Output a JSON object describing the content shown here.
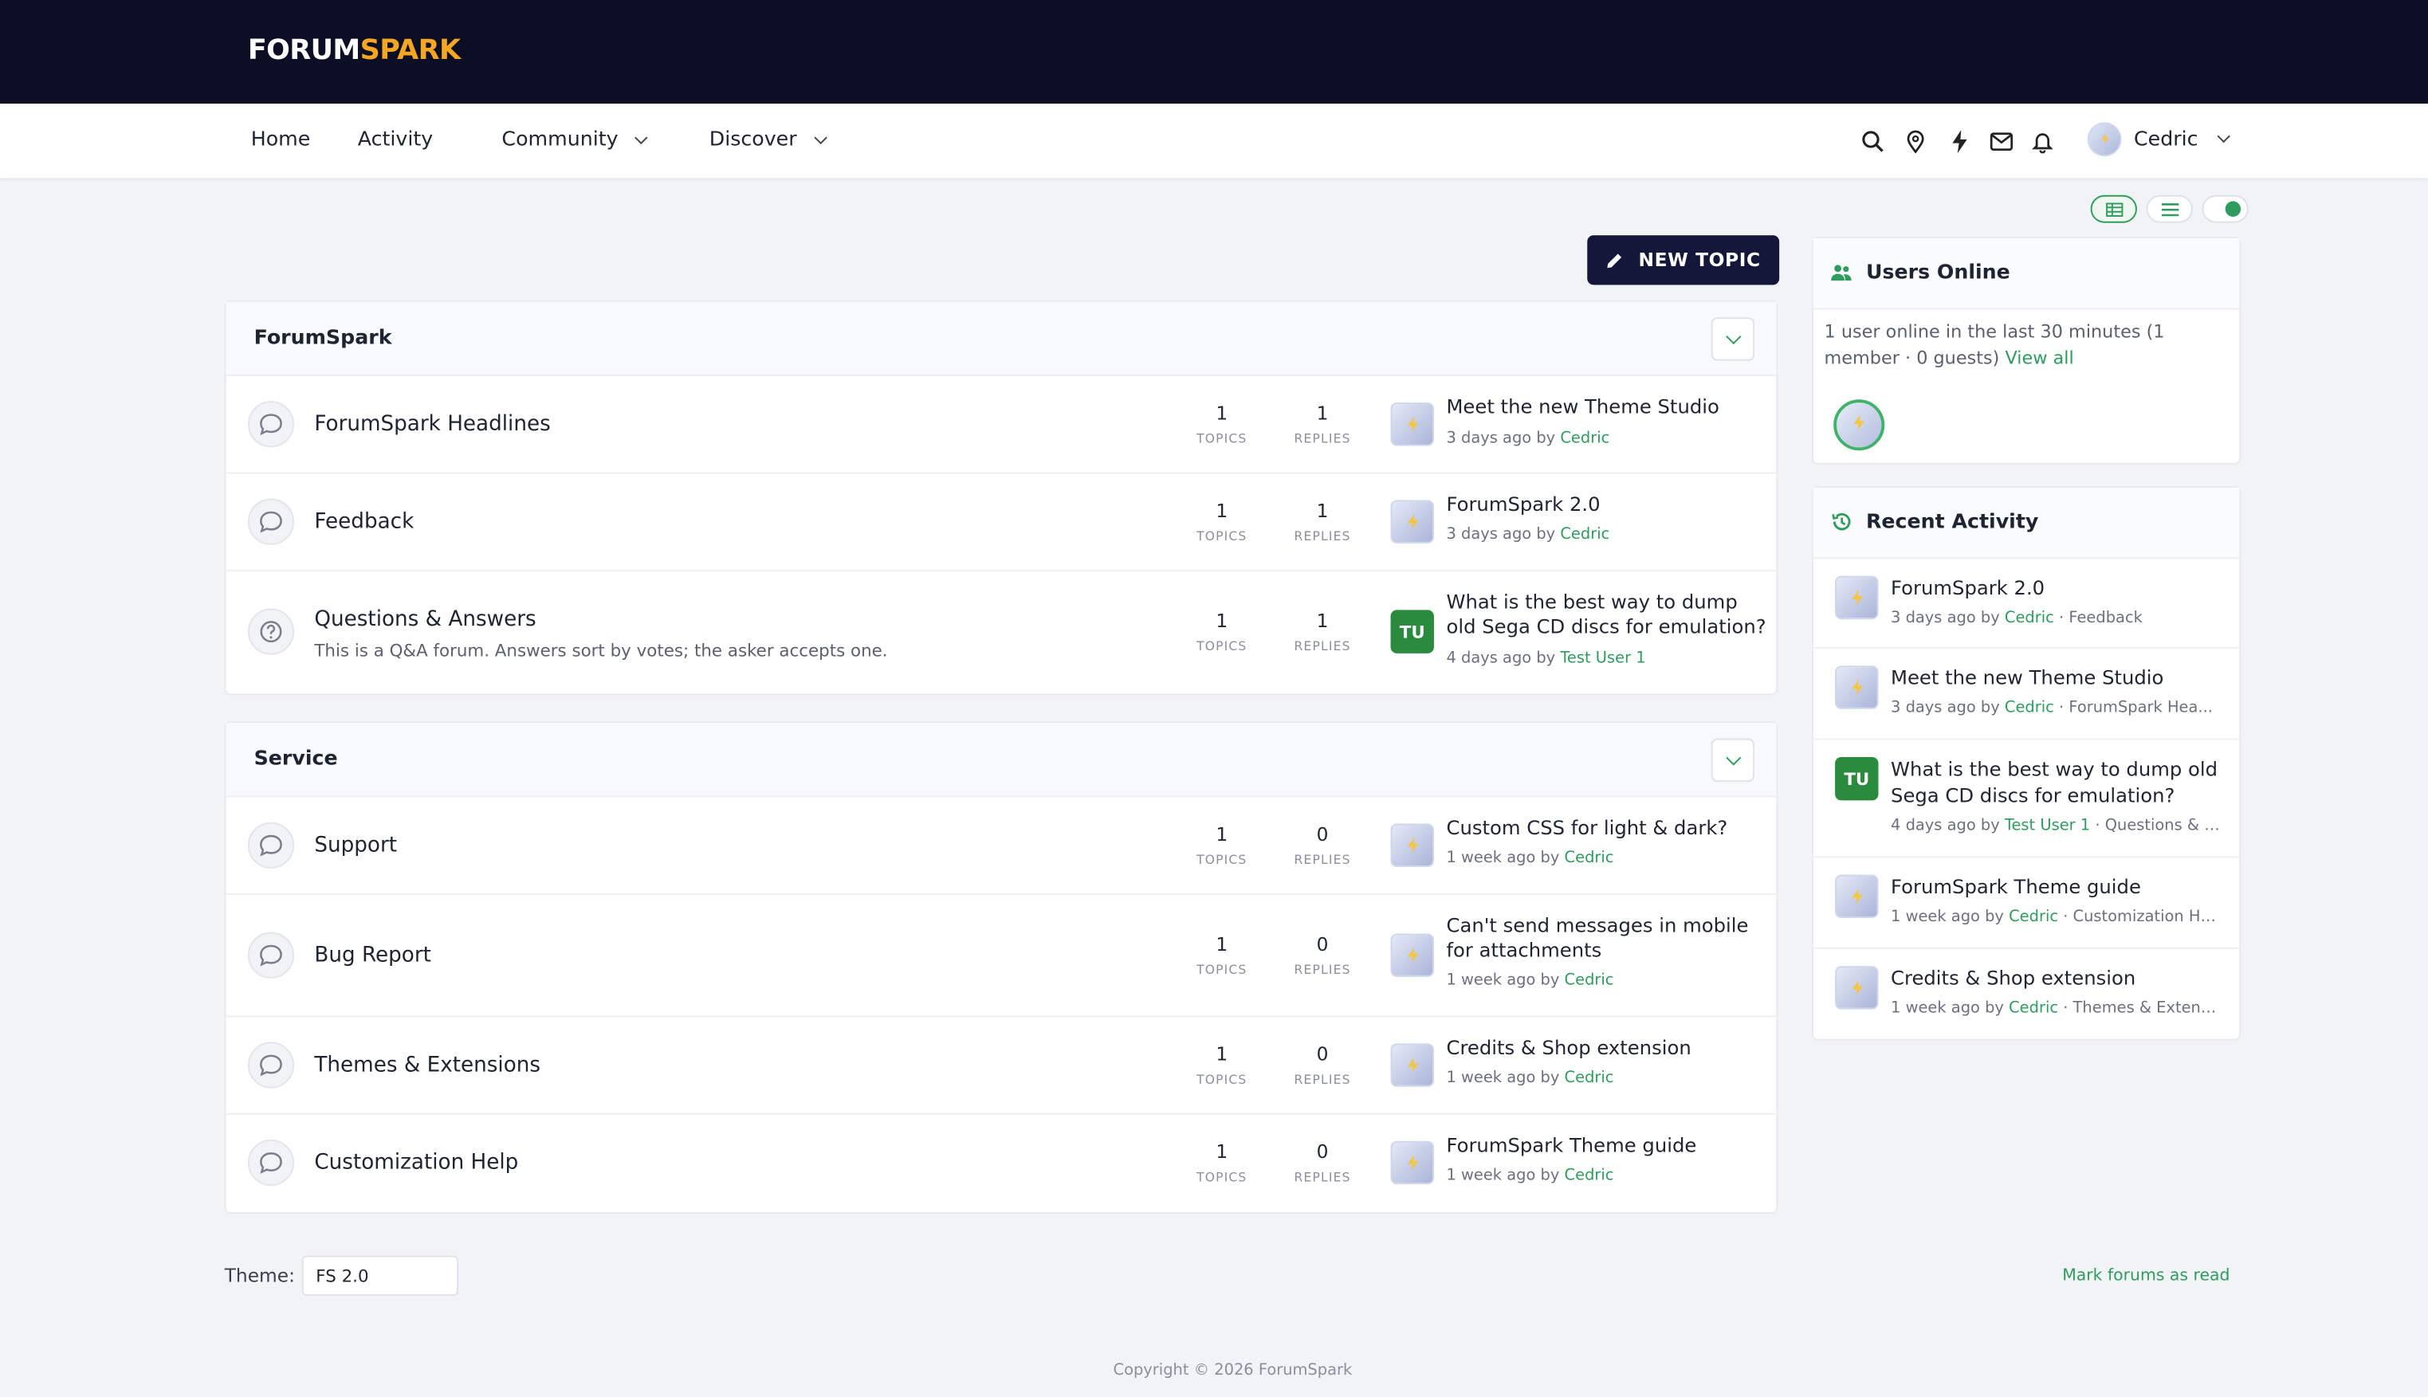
{
  "brand": {
    "logo_left": "FORUM",
    "logo_right": "SPARK"
  },
  "nav": {
    "home": "Home",
    "activity": "Activity",
    "community": "Community",
    "discover": "Discover",
    "user": "Cedric"
  },
  "icons": [
    "search-icon",
    "pin-icon",
    "bolt-icon",
    "mail-icon",
    "bell-icon"
  ],
  "new_topic_label": "NEW TOPIC",
  "colors": {
    "accent": "#2e9c5c",
    "header_bg": "#0c0e25",
    "brand_yellow": "#f5a623"
  },
  "categories": [
    {
      "title": "ForumSpark",
      "forums": [
        {
          "name": "ForumSpark Headlines",
          "desc": "",
          "topics": "1",
          "replies": "1",
          "last_title": "Meet the new Theme Studio",
          "last_when": "3 days ago by ",
          "last_by": "Cedric",
          "avatar": ""
        },
        {
          "name": "Feedback",
          "desc": "",
          "topics": "1",
          "replies": "1",
          "last_title": "ForumSpark 2.0",
          "last_when": "3 days ago by ",
          "last_by": "Cedric",
          "avatar": ""
        },
        {
          "name": "Questions & Answers",
          "desc": "This is a Q&A forum. Answers sort by votes; the asker accepts one.",
          "topics": "1",
          "replies": "1",
          "last_title": "What is the best way to dump old Sega CD discs for emulation?",
          "last_when": "4 days ago by ",
          "last_by": "Test User 1",
          "avatar": "TU"
        }
      ]
    },
    {
      "title": "Service",
      "forums": [
        {
          "name": "Support",
          "desc": "",
          "topics": "1",
          "replies": "0",
          "last_title": "Custom CSS for light & dark?",
          "last_when": "1 week ago by ",
          "last_by": "Cedric",
          "avatar": ""
        },
        {
          "name": "Bug Report",
          "desc": "",
          "topics": "1",
          "replies": "0",
          "last_title": "Can't send messages in mobile for attachments",
          "last_when": "1 week ago by ",
          "last_by": "Cedric",
          "avatar": ""
        },
        {
          "name": "Themes & Extensions",
          "desc": "",
          "topics": "1",
          "replies": "0",
          "last_title": "Credits & Shop extension",
          "last_when": "1 week ago by ",
          "last_by": "Cedric",
          "avatar": ""
        },
        {
          "name": "Customization Help",
          "desc": "",
          "topics": "1",
          "replies": "0",
          "last_title": "ForumSpark Theme guide",
          "last_when": "1 week ago by ",
          "last_by": "Cedric",
          "avatar": ""
        }
      ]
    }
  ],
  "stat_labels": {
    "topics": "TOPICS",
    "replies": "REPLIES"
  },
  "users_online": {
    "title": "Users Online",
    "text": "1 user online in the last 30 minutes (1 member · 0 guests) ",
    "view_all": "View all"
  },
  "recent_activity": {
    "title": "Recent Activity",
    "items": [
      {
        "title": "ForumSpark 2.0",
        "when": "3 days ago by ",
        "by": "Cedric",
        "where": " · Feedback",
        "avatar": ""
      },
      {
        "title": "Meet the new Theme Studio",
        "when": "3 days ago by ",
        "by": "Cedric",
        "where": " · ForumSpark Hea...",
        "avatar": ""
      },
      {
        "title": "What is the best way to dump old Sega CD discs for emulation?",
        "when": "4 days ago by ",
        "by": "Test User 1",
        "where": " · Questions & A...",
        "avatar": "TU"
      },
      {
        "title": "ForumSpark Theme guide",
        "when": "1 week ago by ",
        "by": "Cedric",
        "where": " · Customization He...",
        "avatar": ""
      },
      {
        "title": "Credits & Shop extension",
        "when": "1 week ago by ",
        "by": "Cedric",
        "where": " · Themes & Extensi...",
        "avatar": ""
      }
    ]
  },
  "footer": {
    "theme_label": "Theme:",
    "theme_value": "FS 2.0",
    "mark_read": "Mark forums as read",
    "copyright": "Copyright © 2026 ForumSpark"
  }
}
